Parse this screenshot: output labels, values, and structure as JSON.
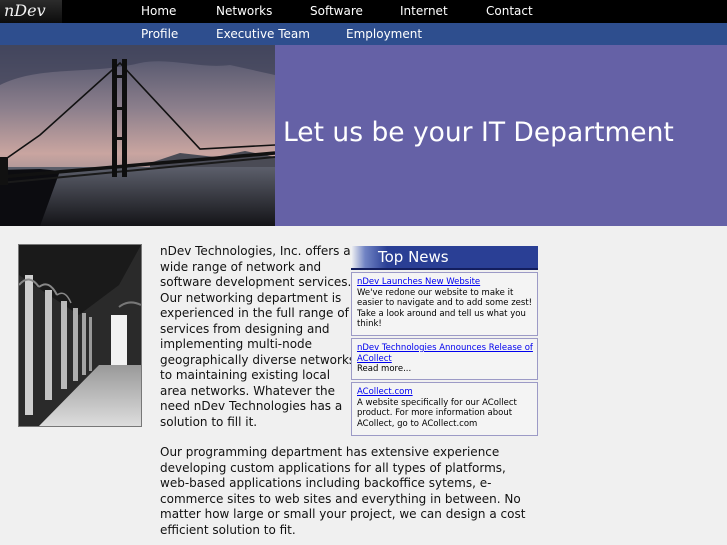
{
  "logo": {
    "text": "nDev"
  },
  "nav_main": [
    "Home",
    "Networks",
    "Software",
    "Internet",
    "Contact"
  ],
  "nav_sub": [
    "Profile",
    "Executive Team",
    "Employment"
  ],
  "hero": {
    "tagline": "Let us be your IT Department"
  },
  "content": {
    "paragraph_1": "nDev Technologies, Inc. offers a wide range of network and software development services. Our networking department is experienced in the full range of services from designing and implementing multi-node geographically diverse networks to maintaining existing local area networks. Whatever the need nDev Technologies has a solution to fill it.",
    "paragraph_2": "Our programming department has extensive experience developing custom applications for all types of platforms, web-based applications including backoffice sytems, e-commerce sites to web sites and everything in between. No matter how large or small your project, we can design a cost efficient solution to fit."
  },
  "top_news": {
    "title": "Top News",
    "items": [
      {
        "link": "nDev Launches New Website",
        "body": "We've redone our website to make it easier to navigate and to add some zest! Take a look around and tell us what you think!"
      },
      {
        "link": "nDev Technologies Announces Release of ACollect",
        "body": "Read more..."
      },
      {
        "link": "ACollect.com",
        "body": "A website specifically for our ACollect product. For more information about ACollect, go to ACollect.com"
      }
    ]
  }
}
